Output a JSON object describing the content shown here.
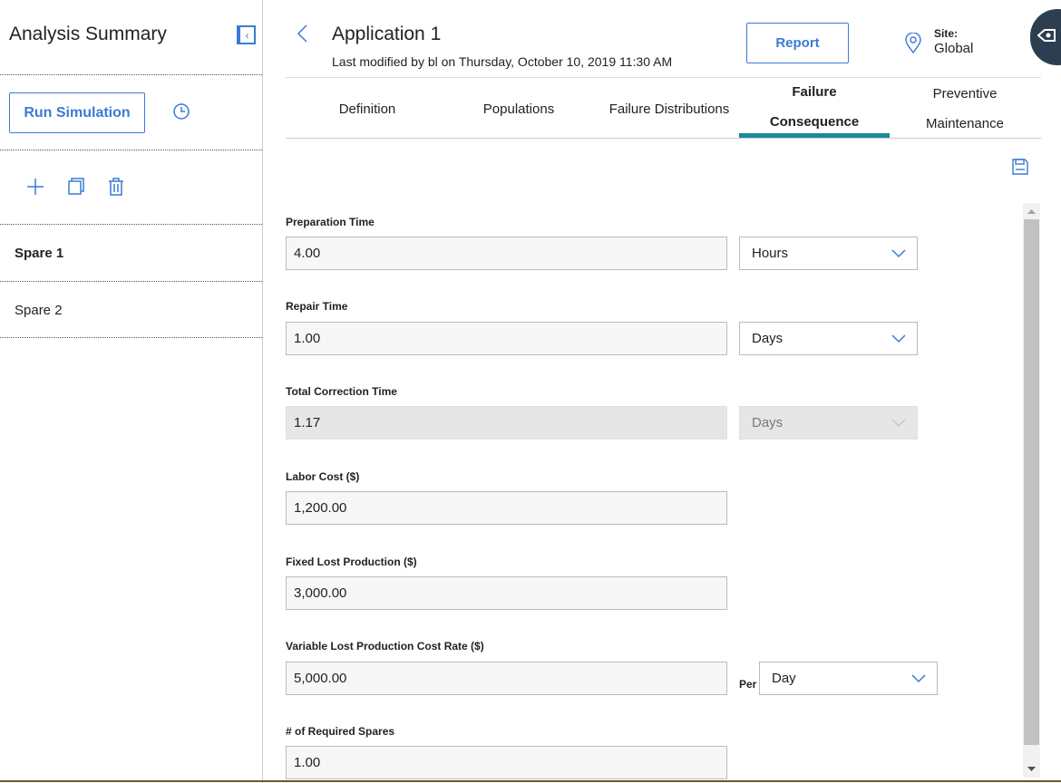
{
  "sidebar": {
    "title": "Analysis Summary",
    "run_simulation_label": "Run Simulation",
    "items": [
      {
        "label": "Spare 1"
      },
      {
        "label": "Spare 2"
      }
    ]
  },
  "header": {
    "title": "Application 1",
    "subtitle": "Last modified by bl on Thursday, October 10, 2019 11:30 AM",
    "report_label": "Report",
    "site_label": "Site:",
    "site_value": "Global"
  },
  "tabs": [
    {
      "label": "Definition",
      "active": false
    },
    {
      "label": "Populations",
      "active": false
    },
    {
      "label": "Failure Distributions",
      "active": false
    },
    {
      "label_line1": "Failure",
      "label_line2": "Consequence",
      "active": true
    },
    {
      "label_line1": "Preventive",
      "label_line2": "Maintenance",
      "active": false
    }
  ],
  "form": {
    "preparation_time": {
      "label": "Preparation Time",
      "value": "4.00",
      "unit": "Hours"
    },
    "repair_time": {
      "label": "Repair Time",
      "value": "1.00",
      "unit": "Days"
    },
    "total_correction_time": {
      "label": "Total Correction Time",
      "value": "1.17",
      "unit": "Days"
    },
    "labor_cost": {
      "label": "Labor Cost ($)",
      "value": "1,200.00"
    },
    "fixed_lost_production": {
      "label": "Fixed Lost Production ($)",
      "value": "3,000.00"
    },
    "variable_lost_production": {
      "label": "Variable Lost Production Cost Rate ($)",
      "value": "5,000.00",
      "per_label": "Per",
      "unit": "Day"
    },
    "required_spares": {
      "label": "# of Required Spares",
      "value": "1.00"
    }
  },
  "colors": {
    "accent": "#3a7bd5",
    "tab_active_underline": "#1a8a9a"
  }
}
